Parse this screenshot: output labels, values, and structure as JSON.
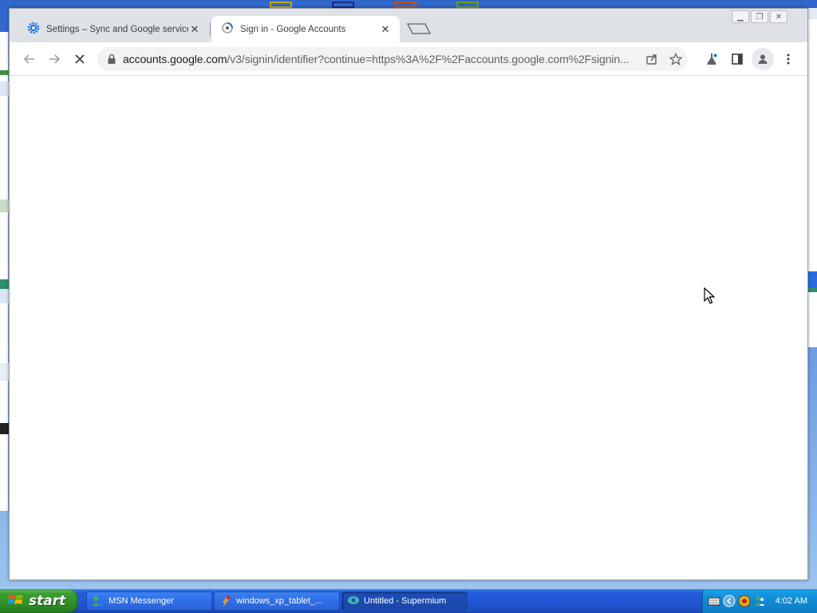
{
  "tabs": [
    {
      "title": "Settings – Sync and Google services",
      "icon": "gear-icon",
      "active": false
    },
    {
      "title": "Sign in - Google Accounts",
      "icon": "loading-spinner-icon",
      "active": true
    }
  ],
  "toolbar": {
    "url_host": "accounts.google.com",
    "url_path": "/v3/signin/identifier?continue=https%3A%2F%2Faccounts.google.com%2Fsignin..."
  },
  "taskbar": {
    "start_label": "start",
    "buttons": [
      {
        "label": "MSN Messenger",
        "icon": "msn-icon",
        "active": false
      },
      {
        "label": "windows_xp_tablet_...",
        "icon": "paint-icon",
        "active": false
      },
      {
        "label": "Untitled - Supermium",
        "icon": "supermium-icon",
        "active": true
      }
    ],
    "clock": "4:02 AM"
  },
  "colors": {
    "tabstrip": "#dee1e6",
    "omnibox": "#f1f3f4",
    "accent_blue": "#1a73e8",
    "xp_taskbar": "#245edb",
    "xp_start": "#3a9d32"
  }
}
